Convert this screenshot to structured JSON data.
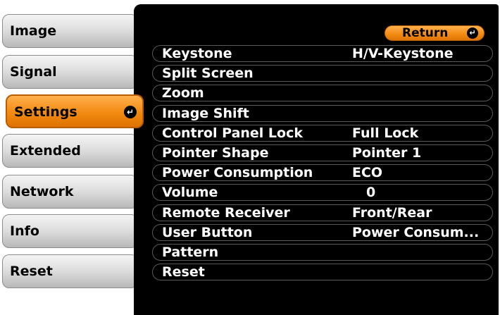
{
  "menu": {
    "tabs": [
      {
        "label": "Image",
        "selected": false
      },
      {
        "label": "Signal",
        "selected": false
      },
      {
        "label": "Settings",
        "selected": true
      },
      {
        "label": "Extended",
        "selected": false
      },
      {
        "label": "Network",
        "selected": false
      },
      {
        "label": "Info",
        "selected": false
      },
      {
        "label": "Reset",
        "selected": false
      }
    ],
    "enter_icon": "enter-icon"
  },
  "panel": {
    "return_label": "Return",
    "items": [
      {
        "label": "Keystone",
        "value": "H/V-Keystone"
      },
      {
        "label": "Split Screen",
        "value": ""
      },
      {
        "label": "Zoom",
        "value": ""
      },
      {
        "label": "Image Shift",
        "value": ""
      },
      {
        "label": "Control Panel Lock",
        "value": "Full Lock"
      },
      {
        "label": "Pointer Shape",
        "value": "Pointer 1"
      },
      {
        "label": "Power Consumption",
        "value": "ECO"
      },
      {
        "label": "Volume",
        "value": "0"
      },
      {
        "label": "Remote Receiver",
        "value": "Front/Rear"
      },
      {
        "label": "User Button",
        "value": "Power Consum..."
      },
      {
        "label": "Pattern",
        "value": ""
      },
      {
        "label": "Reset",
        "value": ""
      }
    ]
  },
  "colors": {
    "accent": "#f28a12",
    "panel_bg": "#000000",
    "tab_bg": "#dcdcdc"
  }
}
